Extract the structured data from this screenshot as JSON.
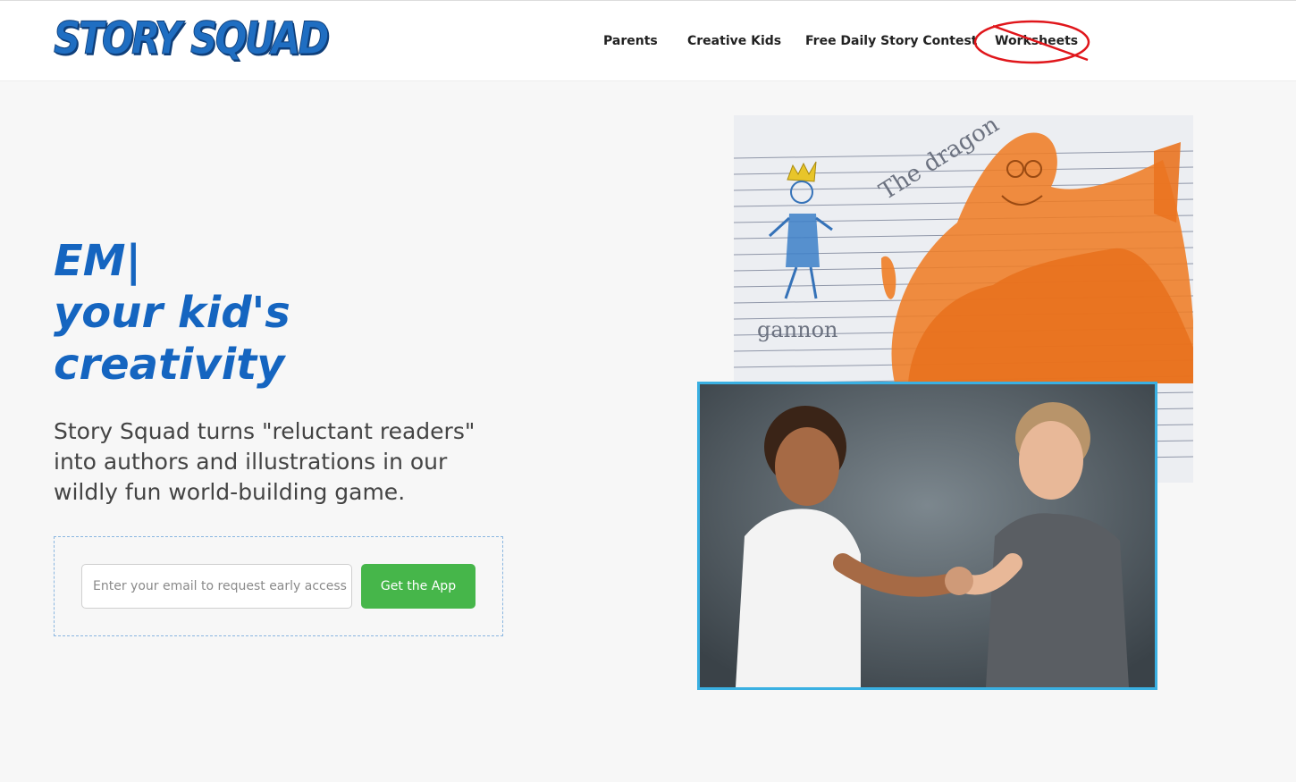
{
  "header": {
    "logo_text": "STORY SQUAD",
    "nav": [
      {
        "label": "Parents"
      },
      {
        "label": "Creative Kids"
      },
      {
        "label": "Free Daily Story Contest"
      },
      {
        "label": "Worksheets"
      }
    ]
  },
  "hero": {
    "headline_lines": [
      "EM|",
      "your kid's",
      "creativity"
    ],
    "subtext": "Story Squad turns \"reluctant readers\" into authors and illustrations in our wildly fun world-building game.",
    "form": {
      "email_placeholder": "Enter your email to request early access",
      "button_label": "Get the App"
    }
  },
  "drawing": {
    "title_text": "The dragon",
    "signature_text": "gannon"
  },
  "colors": {
    "brand_blue": "#1565c0",
    "button_green": "#46b64a",
    "photo_border": "#3ab0e2",
    "annotation_red": "#e0161b"
  }
}
